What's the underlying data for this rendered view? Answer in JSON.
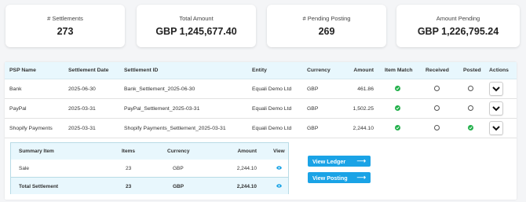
{
  "summary_cards": [
    {
      "label": "# Settlements",
      "value": "273"
    },
    {
      "label": "Total Amount",
      "value": "GBP 1,245,677.40"
    },
    {
      "label": "# Pending Posting",
      "value": "269"
    },
    {
      "label": "Amount Pending",
      "value": "GBP 1,226,795.24"
    }
  ],
  "table": {
    "headers": {
      "psp_name": "PSP Name",
      "settlement_date": "Settlement Date",
      "settlement_id": "Settlement ID",
      "entity": "Entity",
      "currency": "Currency",
      "amount": "Amount",
      "item_match": "Item Match",
      "received": "Received",
      "posted": "Posted",
      "actions": "Actions"
    },
    "rows": [
      {
        "psp_name": "Bank",
        "settlement_date": "2025-06-30",
        "settlement_id": "Bank_Settlement_2025-06-30",
        "entity": "Equali Demo Ltd",
        "currency": "GBP",
        "amount": "461.86",
        "item_match": true,
        "received": false,
        "posted": false
      },
      {
        "psp_name": "PayPal",
        "settlement_date": "2025-03-31",
        "settlement_id": "PayPal_Settlement_2025-03-31",
        "entity": "Equali Demo Ltd",
        "currency": "GBP",
        "amount": "1,502.25",
        "item_match": true,
        "received": false,
        "posted": false
      },
      {
        "psp_name": "Shopify Payments",
        "settlement_date": "2025-03-31",
        "settlement_id": "Shopify Payments_Settlement_2025-03-31",
        "entity": "Equali Demo Ltd",
        "currency": "GBP",
        "amount": "2,244.10",
        "item_match": true,
        "received": false,
        "posted": true
      }
    ]
  },
  "detail": {
    "headers": {
      "summary_item": "Summary Item",
      "items": "Items",
      "currency": "Currency",
      "amount": "Amount",
      "view": "View"
    },
    "rows": [
      {
        "summary_item": "Sale",
        "items": "23",
        "currency": "GBP",
        "amount": "2,244.10"
      }
    ],
    "total": {
      "summary_item": "Total Settlement",
      "items": "23",
      "currency": "GBP",
      "amount": "2,244.10"
    },
    "buttons": {
      "view_ledger": "View Ledger",
      "view_posting": "View Posting"
    }
  },
  "colors": {
    "accent": "#1aa3e6",
    "success": "#22b04b",
    "header_bg": "#e8f7fd"
  },
  "icons": {
    "check": "check-circle-icon",
    "unchecked": "empty-circle-icon",
    "chevron": "chevron-down-icon",
    "eye": "eye-icon",
    "arrow": "arrow-right-icon"
  }
}
